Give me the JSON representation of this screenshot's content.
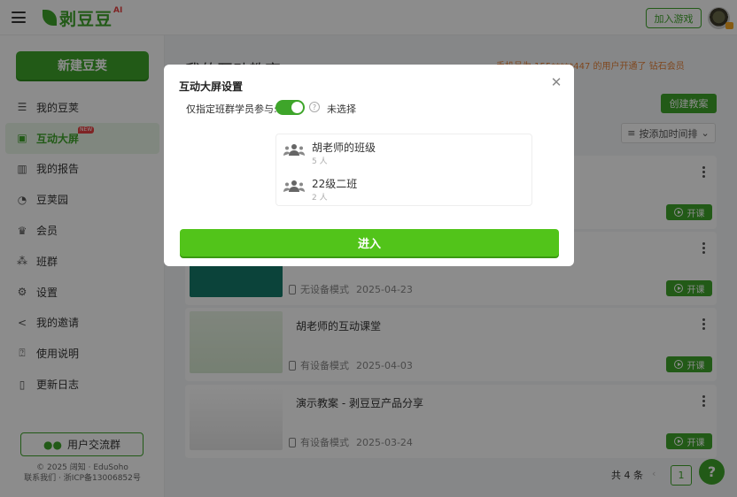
{
  "header": {
    "logo_text": "剥豆豆",
    "logo_ai": "AI",
    "join_game": "加入游戏"
  },
  "sidebar": {
    "new_button": "新建豆荚",
    "items": [
      {
        "label": "我的豆荚",
        "icon": "list-icon"
      },
      {
        "label": "互动大屏",
        "icon": "screen-icon",
        "active": true,
        "tag": "NEW"
      },
      {
        "label": "我的报告",
        "icon": "bar-chart-icon"
      },
      {
        "label": "豆荚园",
        "icon": "palette-icon"
      },
      {
        "label": "会员",
        "icon": "crown-icon"
      },
      {
        "label": "班群",
        "icon": "group-icon"
      },
      {
        "label": "设置",
        "icon": "gear-icon"
      },
      {
        "label": "我的邀请",
        "icon": "share-icon"
      },
      {
        "label": "使用说明",
        "icon": "help-box-icon"
      },
      {
        "label": "更新日志",
        "icon": "bookmark-icon"
      }
    ],
    "group_button": "用户交流群",
    "copyright": "© 2025 阔知 · EduSoho",
    "contact": "联系我们 · 浙ICP备13006852号"
  },
  "main": {
    "title": "我的互动教室",
    "promo": "手机号为 155*****447 的用户开通了 钻石会员",
    "create_button": "创建教案",
    "sort_button": "按添加时间排",
    "cards": [
      {
        "title": "",
        "mode": "",
        "date": "",
        "start": "开课"
      },
      {
        "title": "",
        "mode": "无设备模式",
        "date": "2025-04-23",
        "start": "开课"
      },
      {
        "title": "胡老师的互动课堂",
        "mode": "有设备模式",
        "date": "2025-04-03",
        "start": "开课"
      },
      {
        "title": "演示教案 - 剥豆豆产品分享",
        "mode": "有设备模式",
        "date": "2025-03-24",
        "start": "开课"
      }
    ],
    "total": "共 4 条",
    "page": "1",
    "help": "?"
  },
  "modal": {
    "title": "互动大屏设置",
    "label": "仅指定班群学员参与:",
    "toggle_on": true,
    "unselected": "未选择",
    "classes": [
      {
        "name": "胡老师的班级",
        "count": "5 人"
      },
      {
        "name": "22级二班",
        "count": "2 人"
      }
    ],
    "enter_button": "进入"
  },
  "colors": {
    "brand": "#3ea52a",
    "enter": "#52c41a",
    "promo": "#e8833a"
  }
}
